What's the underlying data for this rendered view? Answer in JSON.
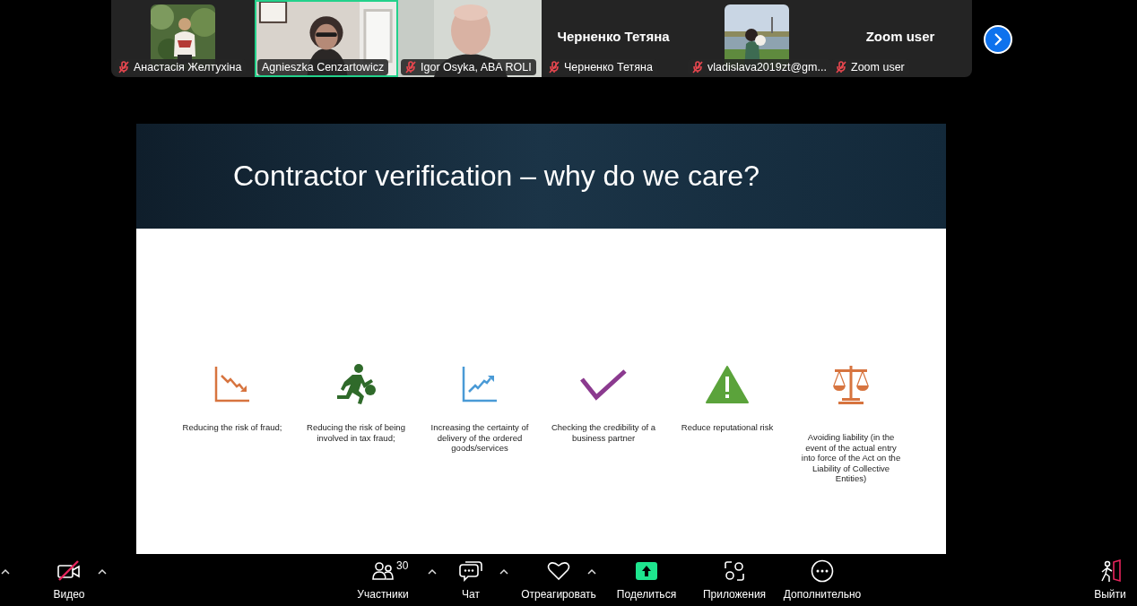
{
  "gallery": {
    "tiles": [
      {
        "name": "Анастасія Желтухіна",
        "muted": true,
        "selected": false
      },
      {
        "kind": "video",
        "name": "Agnieszka Cenzartowicz",
        "muted": false,
        "selected": true
      },
      {
        "kind": "video",
        "name": "Igor Osyka, ABA ROLI",
        "muted": true,
        "selected": false
      },
      {
        "kind": "name",
        "display_name": "Черненко Тетяна",
        "name": "Черненко Тетяна",
        "muted": true,
        "selected": false
      },
      {
        "name": "vladislava2019zt@gm...",
        "muted": true,
        "selected": false
      },
      {
        "kind": "name",
        "display_name": "Zoom user",
        "name": "Zoom user",
        "muted": true,
        "selected": false
      }
    ]
  },
  "slide": {
    "title": "Contractor verification – why do we care?",
    "items": [
      {
        "kind": "decline",
        "text": "Reducing the risk of fraud;"
      },
      {
        "kind": "runner",
        "text": "Reducing the risk of being involved in tax fraud;"
      },
      {
        "kind": "growth",
        "text": "Increasing the certainty of delivery of the ordered goods/services"
      },
      {
        "kind": "check",
        "text": "Checking the credibility of a business partner"
      },
      {
        "kind": "warning",
        "text": "Reduce reputational risk"
      },
      {
        "kind": "scales",
        "text": "Avoiding liability (in the event of the actual entry into force of the Act on the Liability of Collective Entities)"
      }
    ]
  },
  "toolbar": {
    "leading_menu": true,
    "left": {
      "kind": "video",
      "label": "Видео",
      "off": true,
      "menu": true
    },
    "center": [
      {
        "kind": "participants",
        "label": "Участники",
        "count": "30",
        "menu": true
      },
      {
        "kind": "chat",
        "label": "Чат",
        "menu": true
      },
      {
        "kind": "react",
        "label": "Отреагировать",
        "menu": true
      },
      {
        "kind": "share",
        "label": "Поделиться",
        "menu": false
      },
      {
        "kind": "apps",
        "label": "Приложения",
        "menu": false
      },
      {
        "kind": "more",
        "label": "Дополнительно",
        "menu": false
      }
    ],
    "right": {
      "kind": "leave",
      "label": "Выйти",
      "menu": false
    }
  }
}
